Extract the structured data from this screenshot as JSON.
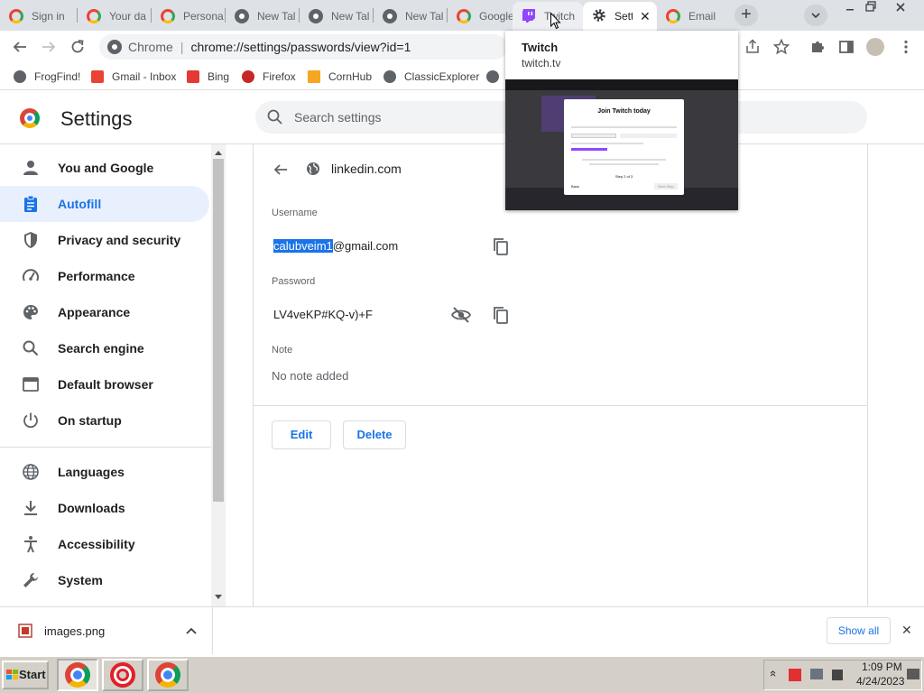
{
  "browser": {
    "tabs": [
      {
        "title": "Sign in",
        "icon": "google-icon"
      },
      {
        "title": "Your da",
        "icon": "google-icon"
      },
      {
        "title": "Persona",
        "icon": "google-icon"
      },
      {
        "title": "New Tal",
        "icon": "chrome-icon"
      },
      {
        "title": "New Tal",
        "icon": "chrome-icon"
      },
      {
        "title": "New Tal",
        "icon": "chrome-icon"
      },
      {
        "title": "Google",
        "icon": "google-icon"
      },
      {
        "title": "Twitch",
        "icon": "twitch-icon"
      },
      {
        "title": "Setti",
        "icon": "gear-icon"
      },
      {
        "title": "Email",
        "icon": "google-icon"
      }
    ],
    "new_tab_label": "+",
    "tab_search_label": "⌄",
    "omnibox": {
      "site_label": "Chrome",
      "separator": "|",
      "url": "chrome://settings/passwords/view?id=1"
    },
    "bookmarks": [
      {
        "label": "FrogFind!",
        "color": "#5f6368"
      },
      {
        "label": "Gmail - Inbox",
        "color": "#ea4335"
      },
      {
        "label": "Bing",
        "color": "#e53935"
      },
      {
        "label": "Firefox",
        "color": "#c62828"
      },
      {
        "label": "CornHub",
        "color": "#f5a623"
      },
      {
        "label": "ClassicExplorer",
        "color": "#5f6368"
      }
    ]
  },
  "tab_preview": {
    "title": "Twitch",
    "url": "twitch.tv",
    "thumbnail": {
      "dialog_title": "Join Twitch today",
      "step_text": "Step 2 of 3",
      "back_label": "Back",
      "next_label": "Next Step"
    }
  },
  "settings": {
    "title": "Settings",
    "search_placeholder": "Search settings",
    "nav_items": [
      {
        "label": "You and Google",
        "icon": "person-icon"
      },
      {
        "label": "Autofill",
        "icon": "clipboard-icon",
        "selected": true
      },
      {
        "label": "Privacy and security",
        "icon": "shield-icon"
      },
      {
        "label": "Performance",
        "icon": "speedometer-icon"
      },
      {
        "label": "Appearance",
        "icon": "palette-icon"
      },
      {
        "label": "Search engine",
        "icon": "search-icon"
      },
      {
        "label": "Default browser",
        "icon": "browser-window-icon"
      },
      {
        "label": "On startup",
        "icon": "power-icon"
      },
      {
        "label": "Languages",
        "icon": "globe-icon"
      },
      {
        "label": "Downloads",
        "icon": "download-icon"
      },
      {
        "label": "Accessibility",
        "icon": "accessibility-icon"
      },
      {
        "label": "System",
        "icon": "wrench-icon"
      }
    ],
    "password_detail": {
      "site": "linkedin.com",
      "username_label": "Username",
      "username_selected": "calubveim1",
      "username_rest": "@gmail.com",
      "password_label": "Password",
      "password_value": "LV4veKP#KQ-v)+F",
      "note_label": "Note",
      "note_value": "No note added",
      "edit_label": "Edit",
      "delete_label": "Delete"
    }
  },
  "download_bar": {
    "file_name": "images.png",
    "show_all_label": "Show all",
    "close_label": "✕"
  },
  "taskbar": {
    "start_label": "Start",
    "clock_time": "1:09 PM",
    "clock_date": "4/24/2023",
    "tray_expand": "«"
  },
  "colors": {
    "accent": "#1a73e8",
    "selected_bg": "#e8f0fe",
    "tabstrip_bg": "#dee1e6"
  }
}
